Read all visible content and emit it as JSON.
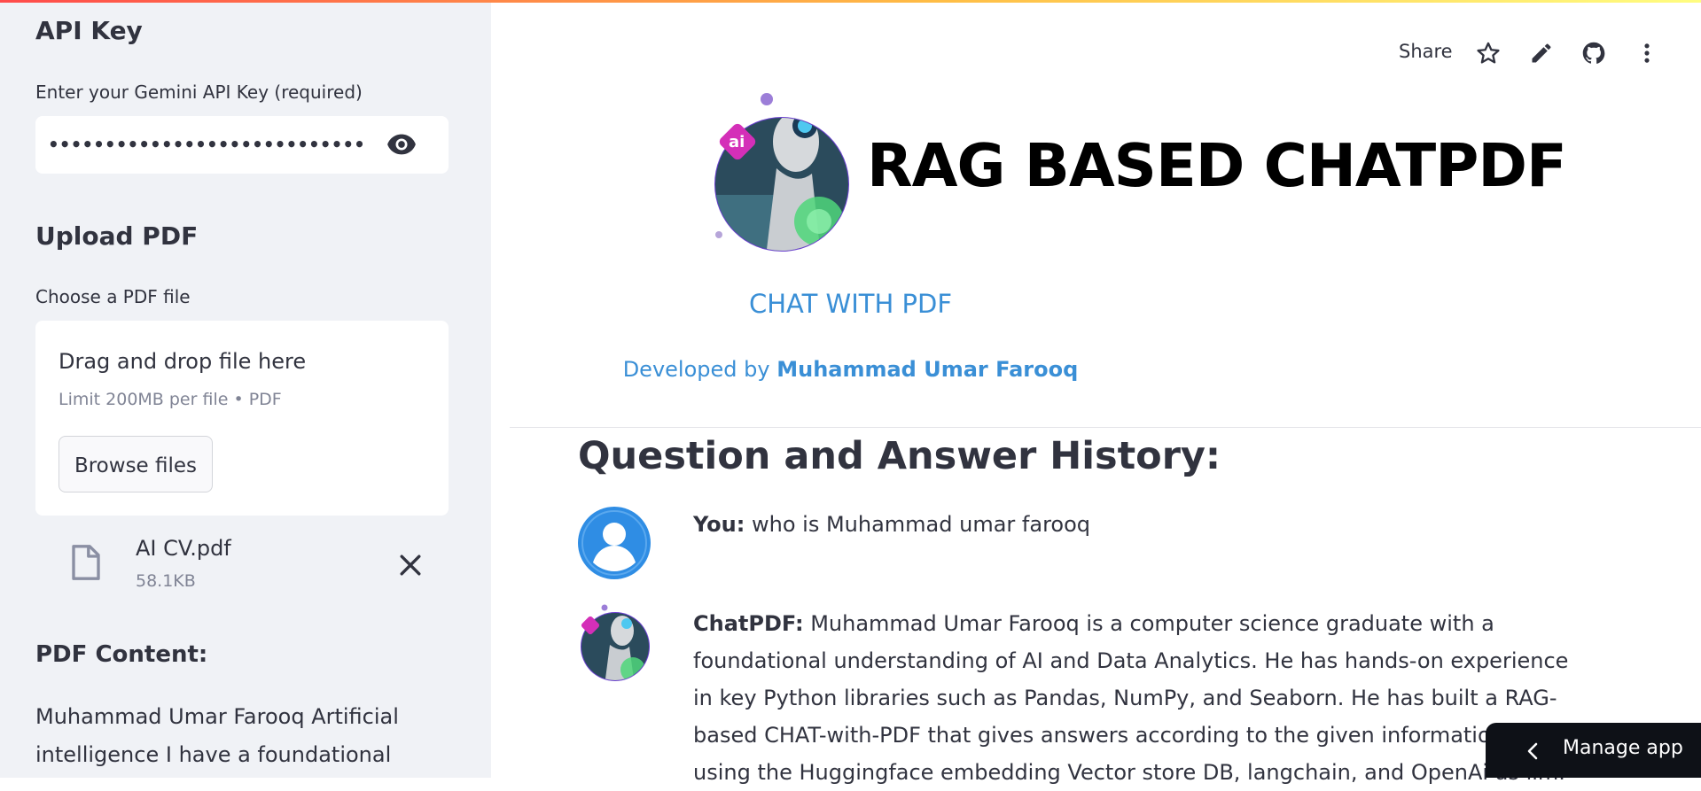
{
  "sidebar": {
    "api_key_heading": "API Key",
    "api_key_label": "Enter your Gemini API Key (required)",
    "api_key_value": "••••••••••••••••••••••••••••••••••••••",
    "upload_heading": "Upload PDF",
    "upload_label": "Choose a PDF file",
    "dropzone": {
      "title": "Drag and drop file here",
      "limit": "Limit 200MB per file • PDF",
      "browse_label": "Browse files"
    },
    "uploaded_file": {
      "name": "AI CV.pdf",
      "size": "58.1KB"
    },
    "pdf_content_heading": "PDF Content:",
    "pdf_content_text": "Muhammad Umar Farooq Artificial intelligence I have a foundational"
  },
  "toolbar": {
    "share_label": "Share",
    "icons": [
      "star-icon",
      "edit-icon",
      "github-icon",
      "more-vert-icon"
    ]
  },
  "header": {
    "title": "RAG BASED CHATPDF",
    "subtitle": "CHAT WITH PDF",
    "developed_prefix": "Developed by",
    "developer_name": "Muhammad Umar Farooq"
  },
  "history": {
    "heading": "Question and Answer History:",
    "messages": [
      {
        "speaker": "You:",
        "text": "who is Muhammad umar farooq"
      },
      {
        "speaker": "ChatPDF:",
        "text": "Muhammad Umar Farooq is a computer science graduate with a foundational understanding of AI and Data Analytics. He has hands-on experience in key Python libraries such as Pandas, NumPy, and Seaborn. He has built a RAG-based CHAT-with-PDF that gives answers according to the given information by using the Huggingface embedding Vector store DB, langchain, and OpenAi as llm."
      }
    ]
  },
  "manage_app": {
    "label": "Manage app"
  },
  "colors": {
    "accent": "#3a8fd6",
    "sidebar_bg": "#f0f2f6",
    "text": "#31333F"
  }
}
